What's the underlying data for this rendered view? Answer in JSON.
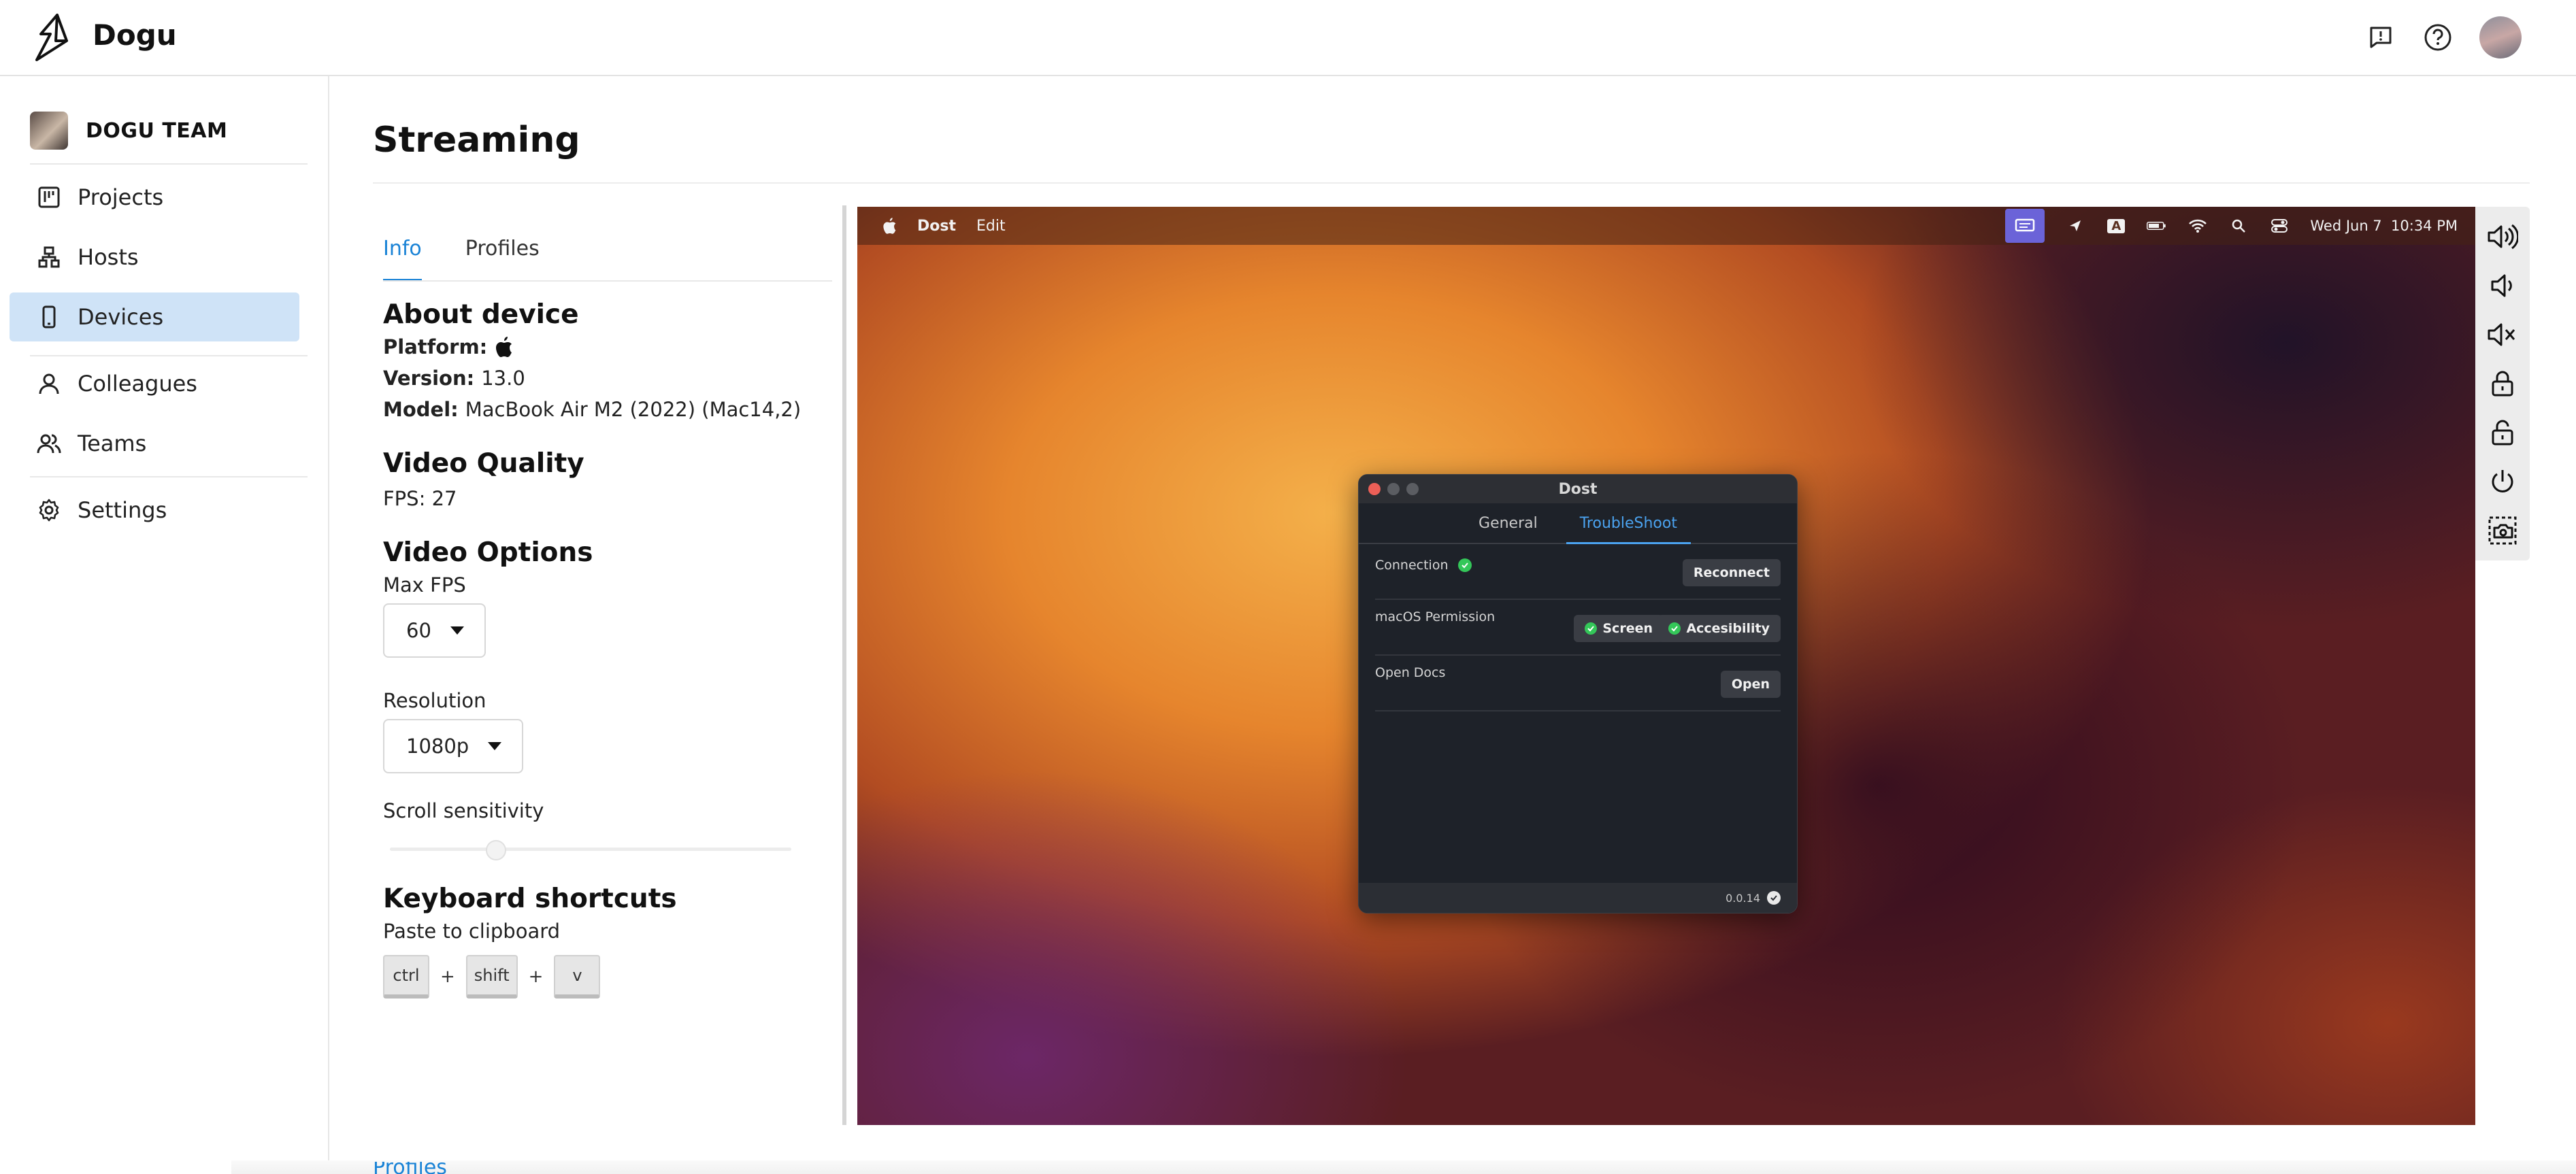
{
  "app": {
    "name": "Dogu"
  },
  "header": {
    "icons": [
      "feedback-icon",
      "help-icon",
      "user-avatar"
    ]
  },
  "sidebar": {
    "team_name": "DOGU TEAM",
    "items": [
      {
        "label": "Projects",
        "icon": "projects-icon"
      },
      {
        "label": "Hosts",
        "icon": "hosts-icon"
      },
      {
        "label": "Devices",
        "icon": "device-icon",
        "active": true
      },
      {
        "label": "Colleagues",
        "icon": "user-icon"
      },
      {
        "label": "Teams",
        "icon": "team-icon"
      },
      {
        "label": "Settings",
        "icon": "gear-icon"
      }
    ]
  },
  "page": {
    "title": "Streaming"
  },
  "tabs": [
    {
      "label": "Info",
      "active": true
    },
    {
      "label": "Profiles"
    }
  ],
  "info": {
    "about_heading": "About device",
    "platform_label": "Platform:",
    "platform_icon": "apple-icon",
    "version_label": "Version:",
    "version_value": "13.0",
    "model_label": "Model:",
    "model_value": "MacBook Air M2 (2022) (Mac14,2)",
    "video_quality_heading": "Video Quality",
    "fps_text": "FPS: 27",
    "video_options_heading": "Video Options",
    "max_fps_label": "Max FPS",
    "max_fps_value": "60",
    "resolution_label": "Resolution",
    "resolution_value": "1080p",
    "scroll_label": "Scroll sensitivity",
    "scroll_value_fraction": 0.25,
    "shortcuts_heading": "Keyboard shortcuts",
    "paste_label": "Paste to clipboard",
    "keys": [
      "ctrl",
      "shift",
      "v"
    ],
    "plus": "+"
  },
  "remote_screen": {
    "menubar": {
      "app": "Dost",
      "edit": "Edit",
      "clock": "Wed Jun 7  10:34 PM",
      "input_source": "A"
    },
    "dost_window": {
      "title": "Dost",
      "tabs": [
        {
          "label": "General"
        },
        {
          "label": "TroubleShoot",
          "active": true
        }
      ],
      "connection_label": "Connection",
      "reconnect_label": "Reconnect",
      "permission_label": "macOS Permission",
      "screen_label": "Screen",
      "accessibility_label": "Accesibility",
      "open_docs_label": "Open Docs",
      "open_label": "Open",
      "version": "0.0.14"
    }
  },
  "controls": [
    "volume-up-icon",
    "volume-down-icon",
    "volume-mute-icon",
    "lock-icon",
    "unlock-icon",
    "power-icon",
    "screenshot-icon"
  ],
  "footer": {
    "link_label": "Profiles"
  },
  "colors": {
    "accent": "#1a83d6",
    "active_nav_bg": "#cfe3f7",
    "menubar_badge": "#6b63d8",
    "ok_green": "#34c759"
  }
}
